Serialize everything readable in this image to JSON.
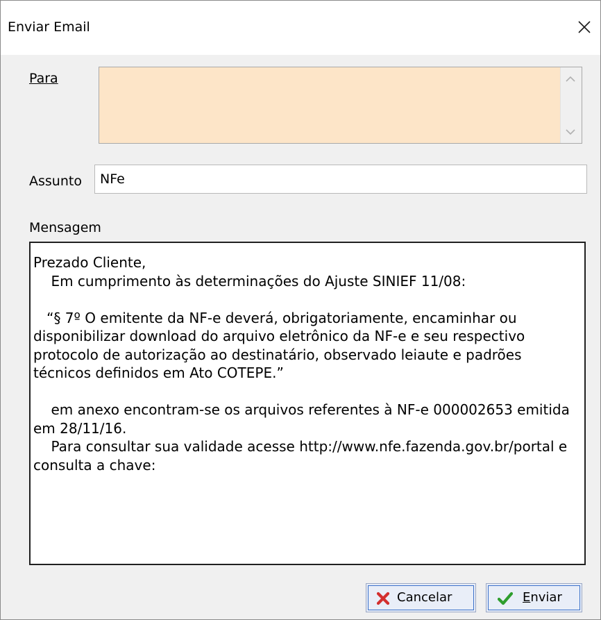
{
  "window": {
    "title": "Enviar Email",
    "close_icon": "close-icon"
  },
  "form": {
    "para_label": "Para",
    "para_value": "",
    "assunto_label": "Assunto",
    "assunto_value": "NFe",
    "mensagem_label": "Mensagem",
    "mensagem_text": "Prezado Cliente,\n    Em cumprimento às determinações do Ajuste SINIEF 11/08:\n\n   “§ 7º O emitente da NF-e deverá, obrigatoriamente, encaminhar ou disponibilizar download do arquivo eletrônico da NF-e e seu respectivo protocolo de autorização ao destinatário, observado leiaute e padrões técnicos definidos em Ato COTEPE.”\n\n    em anexo encontram-se os arquivos referentes à NF-e 000002653 emitida em 28/11/16.\n    Para consultar sua validade acesse http://www.nfe.fazenda.gov.br/portal e consulta a chave:"
  },
  "buttons": {
    "cancel_label": "Cancelar",
    "cancel_icon": "x-icon",
    "send_label": "Enviar",
    "send_icon": "check-icon"
  },
  "colors": {
    "para_background": "#fde5c8",
    "cancel_icon_color": "#d32f2f",
    "send_icon_color": "#2e9e2e",
    "button_focus_border": "#3a70c9"
  }
}
